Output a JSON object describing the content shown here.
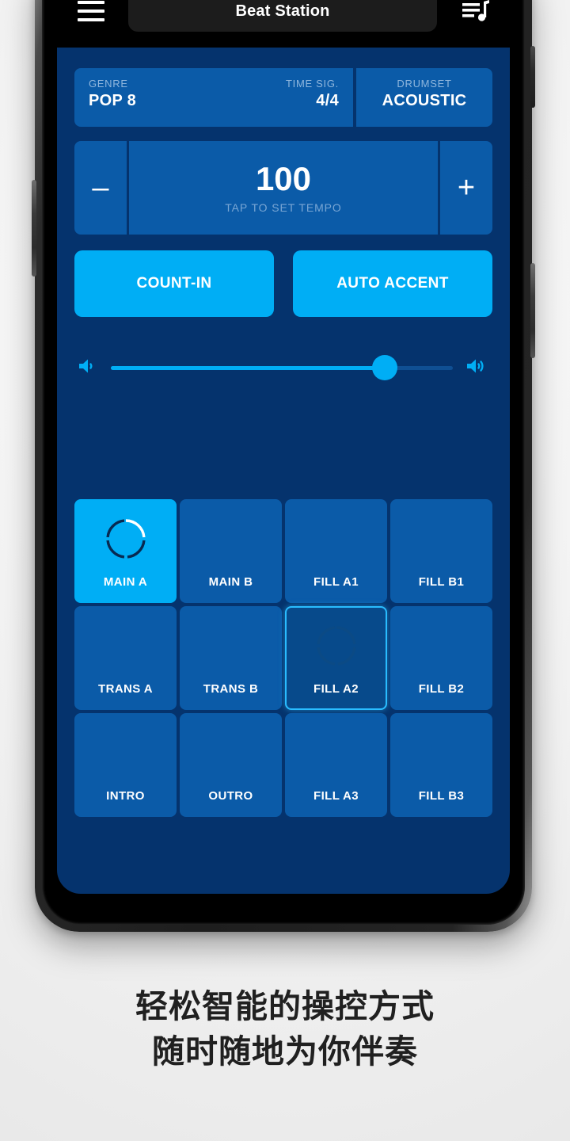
{
  "promo": {
    "caption_line1": "轻松智能的操控方式",
    "caption_line2": "随时随地为你伴奏"
  },
  "app_bar": {
    "menu_icon": "hamburger-menu-icon",
    "title": "Beat Station",
    "queue_icon": "playlist-queue-icon"
  },
  "info_bar": {
    "genre": {
      "label": "GENRE",
      "value": "POP 8"
    },
    "time_signature": {
      "label": "TIME SIG.",
      "value": "4/4"
    },
    "drumset": {
      "label": "DRUMSET",
      "value": "ACOUSTIC"
    }
  },
  "tempo": {
    "decrease_label": "–",
    "increase_label": "+",
    "value": "100",
    "hint": "TAP TO SET TEMPO"
  },
  "toggles": {
    "count_in": "COUNT-IN",
    "auto_accent": "AUTO ACCENT"
  },
  "volume": {
    "min_icon": "volume-low-icon",
    "max_icon": "volume-high-icon",
    "level_percent": 80
  },
  "pads": [
    {
      "label": "MAIN A",
      "state": "active",
      "ring": true
    },
    {
      "label": "MAIN B",
      "state": "idle",
      "ring": false
    },
    {
      "label": "FILL A1",
      "state": "idle",
      "ring": false
    },
    {
      "label": "FILL B1",
      "state": "idle",
      "ring": false
    },
    {
      "label": "TRANS A",
      "state": "idle",
      "ring": false
    },
    {
      "label": "TRANS B",
      "state": "idle",
      "ring": false
    },
    {
      "label": "FILL A2",
      "state": "queued",
      "ring": true
    },
    {
      "label": "FILL B2",
      "state": "idle",
      "ring": false
    },
    {
      "label": "INTRO",
      "state": "idle",
      "ring": false
    },
    {
      "label": "OUTRO",
      "state": "idle",
      "ring": false
    },
    {
      "label": "FILL A3",
      "state": "idle",
      "ring": false
    },
    {
      "label": "FILL B3",
      "state": "idle",
      "ring": false
    }
  ],
  "colors": {
    "app_background": "#05336D",
    "pad_idle": "#0B5BA8",
    "accent_cyan": "#00AEF5",
    "app_bar": "#000000",
    "title_pill": "#1C1C1C",
    "muted_label": "#8FB6DD",
    "page_background": "#F2F2F2"
  }
}
